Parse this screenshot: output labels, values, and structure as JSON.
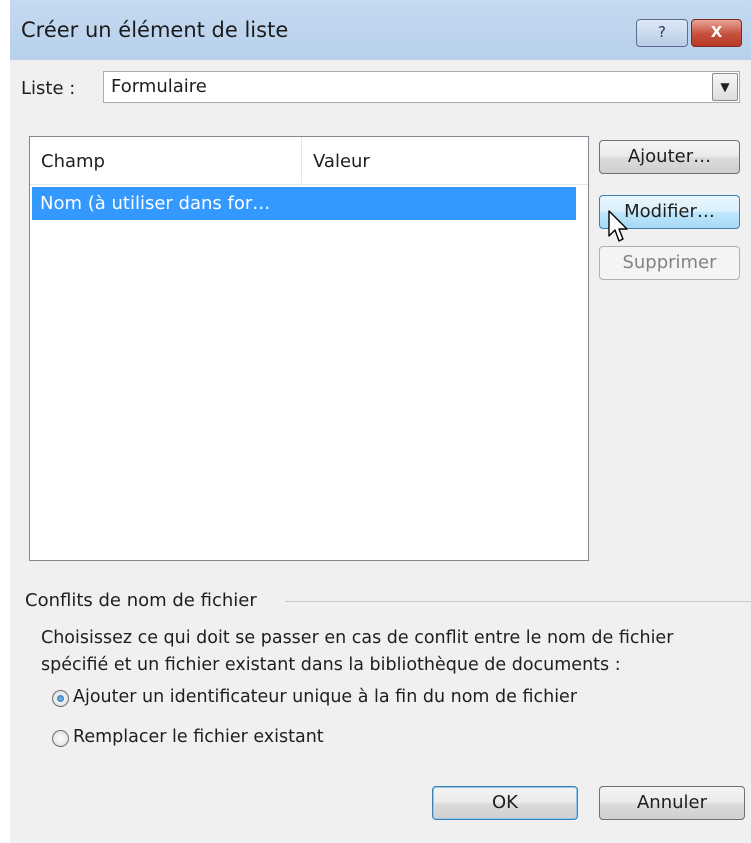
{
  "dialog": {
    "title": "Créer un élément de liste",
    "help_glyph": "?",
    "close_glyph": "X"
  },
  "list_selector": {
    "label": "Liste :",
    "value": "Formulaire"
  },
  "fields_table": {
    "columns": [
      "Champ",
      "Valeur"
    ],
    "rows": [
      {
        "champ": "Nom (à utiliser dans for…",
        "valeur": "",
        "selected": true
      }
    ]
  },
  "side_buttons": {
    "add": "Ajouter…",
    "modify": "Modifier…",
    "delete": "Supprimer"
  },
  "conflicts": {
    "group_label": "Conflits de nom de fichier",
    "description_line1": "Choisissez ce qui doit se passer en cas de conflit entre le nom de fichier",
    "description_line2": "spécifié et un fichier existant dans la bibliothèque de documents :",
    "options": [
      {
        "label": "Ajouter un identificateur unique à la fin du nom de fichier",
        "selected": true
      },
      {
        "label": "Remplacer le fichier existant",
        "selected": false
      }
    ]
  },
  "footer": {
    "ok": "OK",
    "cancel": "Annuler"
  },
  "colors": {
    "selection": "#3399ff",
    "titlebar": "#b9d1ea",
    "close_button": "#c5503d"
  }
}
